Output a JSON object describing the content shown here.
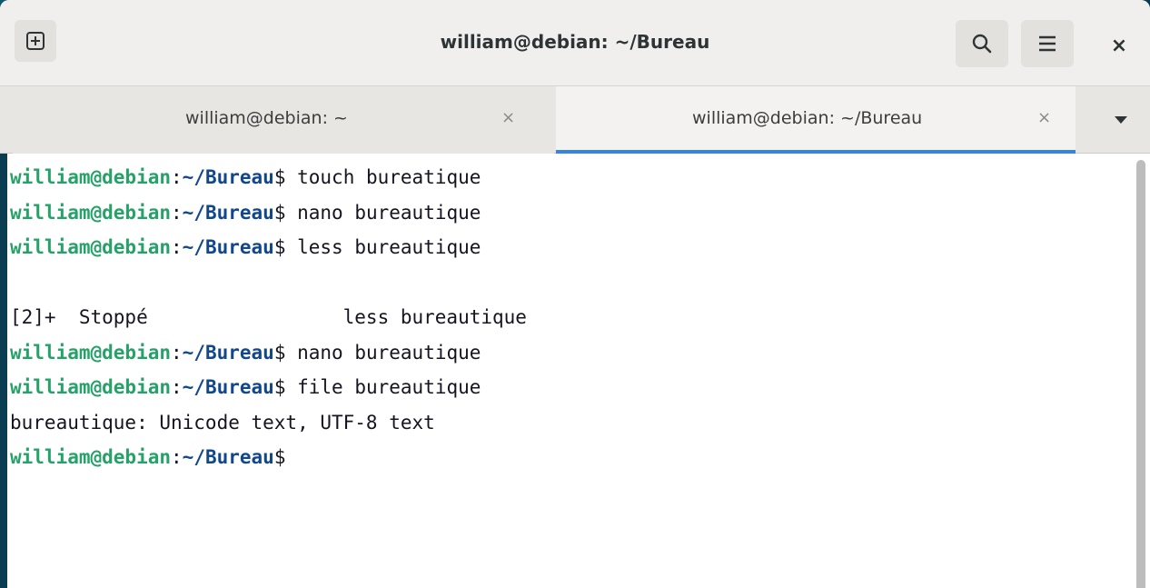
{
  "window": {
    "title": "william@debian: ~/Bureau"
  },
  "tabs": [
    {
      "label": "william@debian: ~",
      "close": "×",
      "active": false
    },
    {
      "label": "william@debian: ~/Bureau",
      "close": "×",
      "active": true
    }
  ],
  "headerbar": {
    "new_tab_icon": "plus-square-icon",
    "search_icon": "search-icon",
    "menu_icon": "hamburger-menu-icon",
    "close_label": "×",
    "tab_list_icon": "chevron-down-icon"
  },
  "prompt": {
    "user": "william@debian",
    "sep": ":",
    "path": "~/Bureau",
    "symbol": "$"
  },
  "lines": [
    {
      "type": "cmd",
      "text": " touch bureatique"
    },
    {
      "type": "cmd",
      "text": " nano bureautique"
    },
    {
      "type": "cmd",
      "text": " less bureautique"
    },
    {
      "type": "out",
      "text": ""
    },
    {
      "type": "out",
      "text": "[2]+  Stoppé                 less bureautique"
    },
    {
      "type": "cmd",
      "text": " nano bureautique"
    },
    {
      "type": "cmd",
      "text": " file bureautique"
    },
    {
      "type": "out",
      "text": "bureautique: Unicode text, UTF-8 text"
    },
    {
      "type": "cmd",
      "text": ""
    }
  ],
  "colors": {
    "user": "#26a269",
    "path": "#12488b",
    "accent": "#3584e4"
  }
}
